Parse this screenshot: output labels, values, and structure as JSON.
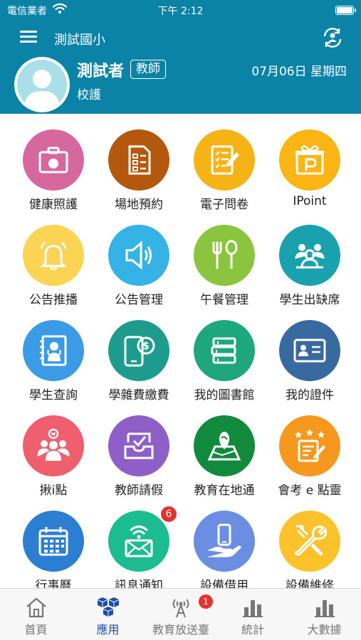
{
  "status_bar": {
    "carrier": "電信業者",
    "time": "下午 2:12"
  },
  "header": {
    "school_name": "測試國小"
  },
  "profile": {
    "name": "測試者",
    "role_badge": "教師",
    "date": "07月06日 星期四",
    "role": "校護"
  },
  "apps": [
    {
      "label": "健康照護",
      "icon": "medical-kit-icon",
      "color": "#d6689e"
    },
    {
      "label": "場地預約",
      "icon": "checklist-icon",
      "color": "#b3580c"
    },
    {
      "label": "電子問卷",
      "icon": "survey-icon",
      "color": "#f5b316"
    },
    {
      "label": "IPoint",
      "icon": "gift-p-icon",
      "color": "#fbb514"
    },
    {
      "label": "公告推播",
      "icon": "bell-icon",
      "color": "#fbd454"
    },
    {
      "label": "公告管理",
      "icon": "speaker-icon",
      "color": "#35b3e7"
    },
    {
      "label": "午餐管理",
      "icon": "fork-spoon-icon",
      "color": "#8bc53f"
    },
    {
      "label": "學生出缺席",
      "icon": "students-icon",
      "color": "#1aa1ae"
    },
    {
      "label": "學生查詢",
      "icon": "student-book-icon",
      "color": "#3c9be6"
    },
    {
      "label": "學雜費繳費",
      "icon": "phone-payment-icon",
      "color": "#1d9b8c"
    },
    {
      "label": "我的圖書館",
      "icon": "books-icon",
      "color": "#1ea77d"
    },
    {
      "label": "我的證件",
      "icon": "id-card-icon",
      "color": "#386aa0"
    },
    {
      "label": "揪i點",
      "icon": "group-heart-icon",
      "color": "#ef5f6e"
    },
    {
      "label": "教師請假",
      "icon": "inbox-check-icon",
      "color": "#8d5fc7"
    },
    {
      "label": "教育在地通",
      "icon": "map-pin-icon",
      "color": "#128a3d"
    },
    {
      "label": "會考 e 點靈",
      "icon": "exam-stars-icon",
      "color": "#f7981e"
    },
    {
      "label": "行事曆",
      "icon": "calendar-icon",
      "color": "#2c7ed3"
    },
    {
      "label": "訊息通知",
      "icon": "mail-wifi-icon",
      "color": "#1bbc8f",
      "badge": "6"
    },
    {
      "label": "設備借用",
      "icon": "phone-hand-icon",
      "color": "#6b8de2"
    },
    {
      "label": "設備維修",
      "icon": "tools-icon",
      "color": "#fbc22c"
    }
  ],
  "tabs": [
    {
      "label": "首頁",
      "icon": "home-icon"
    },
    {
      "label": "應用",
      "icon": "cubes-icon",
      "active": true
    },
    {
      "label": "教育放送臺",
      "icon": "antenna-icon",
      "badge": "1"
    },
    {
      "label": "統計",
      "icon": "bar-chart-icon"
    },
    {
      "label": "大數據",
      "icon": "big-data-icon"
    }
  ],
  "colors": {
    "header_bg": "#0b83a6",
    "active_tab": "#1c4fa3",
    "badge": "#e5322d"
  }
}
